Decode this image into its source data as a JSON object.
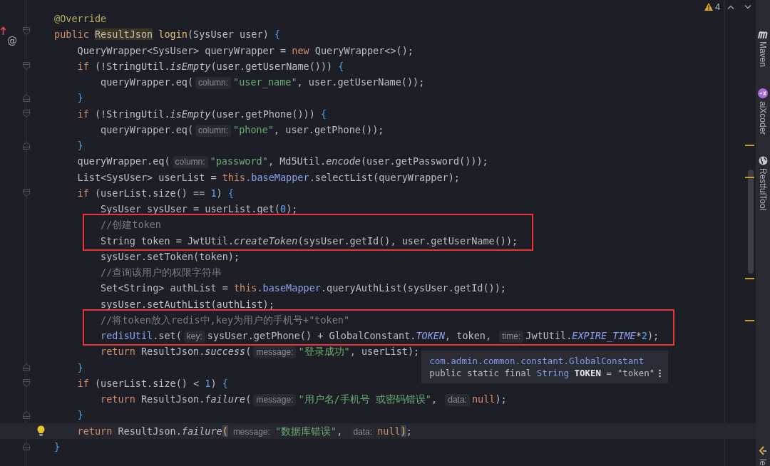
{
  "inspection": {
    "count": "4"
  },
  "lines": [
    {
      "current": false,
      "tokens": [
        {
          "kind": "annotation",
          "text": "@Override"
        }
      ]
    },
    {
      "current": false,
      "gutter": [
        {
          "kind": "override-arrow"
        },
        {
          "kind": "fold-start"
        }
      ],
      "gutter_label": "@",
      "tokens": [
        {
          "kind": "keyword",
          "text": "public "
        },
        {
          "kind": "usage",
          "text": "ResultJson"
        },
        {
          "kind": "method",
          "text": " login"
        },
        {
          "kind": "plain",
          "text": "(SysUser user) "
        },
        {
          "kind": "brace",
          "text": "{"
        }
      ]
    },
    {
      "current": false,
      "tokens": [
        {
          "kind": "plain",
          "text": "    QueryWrapper<SysUser> queryWrapper = "
        },
        {
          "kind": "keyword",
          "text": "new"
        },
        {
          "kind": "plain",
          "text": " QueryWrapper<>();"
        }
      ]
    },
    {
      "current": false,
      "gutter": [
        {
          "kind": "fold-start"
        }
      ],
      "tokens": [
        {
          "kind": "keyword",
          "text": "    if"
        },
        {
          "kind": "plain",
          "text": " (!StringUtil."
        },
        {
          "kind": "static-call",
          "text": "isEmpty"
        },
        {
          "kind": "plain",
          "text": "(user.getUserName())) "
        },
        {
          "kind": "brace",
          "text": "{"
        }
      ]
    },
    {
      "current": false,
      "tokens": [
        {
          "kind": "plain",
          "text": "        queryWrapper.eq("
        },
        {
          "kind": "hint",
          "text": "column:"
        },
        {
          "kind": "string",
          "text": "\"user_name\""
        },
        {
          "kind": "plain",
          "text": ", user.getUserName());"
        }
      ]
    },
    {
      "current": false,
      "gutter": [
        {
          "kind": "fold-end"
        }
      ],
      "tokens": [
        {
          "kind": "brace",
          "text": "    }"
        }
      ]
    },
    {
      "current": false,
      "gutter": [
        {
          "kind": "fold-start"
        }
      ],
      "tokens": [
        {
          "kind": "keyword",
          "text": "    if"
        },
        {
          "kind": "plain",
          "text": " (!StringUtil."
        },
        {
          "kind": "static-call",
          "text": "isEmpty"
        },
        {
          "kind": "plain",
          "text": "(user.getPhone())) "
        },
        {
          "kind": "brace",
          "text": "{"
        }
      ]
    },
    {
      "current": false,
      "tokens": [
        {
          "kind": "plain",
          "text": "        queryWrapper.eq("
        },
        {
          "kind": "hint",
          "text": "column:"
        },
        {
          "kind": "string",
          "text": "\"phone\""
        },
        {
          "kind": "plain",
          "text": ", user.getPhone());"
        }
      ]
    },
    {
      "current": false,
      "gutter": [
        {
          "kind": "fold-end"
        }
      ],
      "tokens": [
        {
          "kind": "brace",
          "text": "    }"
        }
      ]
    },
    {
      "current": false,
      "tokens": [
        {
          "kind": "plain",
          "text": "    queryWrapper.eq("
        },
        {
          "kind": "hint",
          "text": "column:"
        },
        {
          "kind": "string",
          "text": "\"password\""
        },
        {
          "kind": "plain",
          "text": ", Md5Util."
        },
        {
          "kind": "static-call",
          "text": "encode"
        },
        {
          "kind": "plain",
          "text": "(user.getPassword()));"
        }
      ]
    },
    {
      "current": false,
      "tokens": [
        {
          "kind": "plain",
          "text": "    List<SysUser> userList = "
        },
        {
          "kind": "keyword",
          "text": "this"
        },
        {
          "kind": "field",
          "text": ".baseMapper"
        },
        {
          "kind": "plain",
          "text": ".selectList(queryWrapper);"
        }
      ]
    },
    {
      "current": false,
      "gutter": [
        {
          "kind": "fold-start"
        }
      ],
      "tokens": [
        {
          "kind": "keyword",
          "text": "    if"
        },
        {
          "kind": "plain",
          "text": " (userList.size() == "
        },
        {
          "kind": "number",
          "text": "1"
        },
        {
          "kind": "plain",
          "text": ") "
        },
        {
          "kind": "brace",
          "text": "{"
        }
      ]
    },
    {
      "current": false,
      "tokens": [
        {
          "kind": "plain",
          "text": "        SysUser sysUser = userList.get("
        },
        {
          "kind": "number",
          "text": "0"
        },
        {
          "kind": "plain",
          "text": ");"
        }
      ]
    },
    {
      "current": false,
      "highlight": true,
      "tokens": [
        {
          "kind": "comment",
          "text": "        //创建token"
        }
      ]
    },
    {
      "current": false,
      "highlight": true,
      "tokens": [
        {
          "kind": "plain",
          "text": "        String token = JwtUtil."
        },
        {
          "kind": "static-call",
          "text": "createToken"
        },
        {
          "kind": "plain",
          "text": "(sysUser.getId(), user.getUserName());"
        }
      ]
    },
    {
      "current": false,
      "tokens": [
        {
          "kind": "plain",
          "text": "        sysUser.setToken(token);"
        }
      ]
    },
    {
      "current": false,
      "tokens": [
        {
          "kind": "comment",
          "text": "        //查询该用户的权限字符串"
        }
      ]
    },
    {
      "current": false,
      "tokens": [
        {
          "kind": "plain",
          "text": "        Set<String> authList = "
        },
        {
          "kind": "keyword",
          "text": "this"
        },
        {
          "kind": "field",
          "text": ".baseMapper"
        },
        {
          "kind": "plain",
          "text": ".queryAuthList(sysUser.getId());"
        }
      ]
    },
    {
      "current": false,
      "tokens": [
        {
          "kind": "plain",
          "text": "        sysUser.setAuthList(authList);"
        }
      ]
    },
    {
      "current": false,
      "highlight": true,
      "tokens": [
        {
          "kind": "comment",
          "text": "        //将token放入redis中,key为用户的手机号+\"token\""
        }
      ]
    },
    {
      "current": false,
      "highlight": true,
      "tokens": [
        {
          "kind": "field",
          "text": "        redisUtil"
        },
        {
          "kind": "plain",
          "text": ".set("
        },
        {
          "kind": "hint",
          "text": "key:"
        },
        {
          "kind": "plain",
          "text": "sysUser.getPhone() + GlobalConstant."
        },
        {
          "kind": "static-field",
          "text": "TOKEN"
        },
        {
          "kind": "plain",
          "text": ", token, "
        },
        {
          "kind": "hint",
          "text": "time:"
        },
        {
          "kind": "plain",
          "text": "JwtUtil."
        },
        {
          "kind": "static-field",
          "text": "EXPIRE_TIME"
        },
        {
          "kind": "plain",
          "text": "*"
        },
        {
          "kind": "number",
          "text": "2"
        },
        {
          "kind": "plain",
          "text": ");"
        }
      ]
    },
    {
      "current": false,
      "tokens": [
        {
          "kind": "keyword",
          "text": "        return"
        },
        {
          "kind": "plain",
          "text": " ResultJson."
        },
        {
          "kind": "static-call",
          "text": "success"
        },
        {
          "kind": "plain",
          "text": "("
        },
        {
          "kind": "hint",
          "text": "message:"
        },
        {
          "kind": "string",
          "text": "\"登录成功\""
        },
        {
          "kind": "plain",
          "text": ", userList);"
        }
      ],
      "tooltip": {
        "location": "com.admin.common.constant.GlobalConstant",
        "tokens": [
          {
            "kind": "plain",
            "text": "public static final "
          },
          {
            "kind": "type",
            "text": "String"
          },
          {
            "kind": "name",
            "text": " TOKEN"
          },
          {
            "kind": "plain",
            "text": " = \"token\""
          }
        ]
      }
    },
    {
      "current": false,
      "gutter": [
        {
          "kind": "fold-end"
        }
      ],
      "tokens": [
        {
          "kind": "brace",
          "text": "    }"
        }
      ]
    },
    {
      "current": false,
      "gutter": [
        {
          "kind": "fold-start"
        }
      ],
      "tokens": [
        {
          "kind": "keyword",
          "text": "    if"
        },
        {
          "kind": "plain",
          "text": " (userList.size() < "
        },
        {
          "kind": "number",
          "text": "1"
        },
        {
          "kind": "plain",
          "text": ") "
        },
        {
          "kind": "brace",
          "text": "{"
        }
      ]
    },
    {
      "current": false,
      "tokens": [
        {
          "kind": "keyword",
          "text": "        return"
        },
        {
          "kind": "plain",
          "text": " ResultJson."
        },
        {
          "kind": "static-call",
          "text": "failure"
        },
        {
          "kind": "plain",
          "text": "("
        },
        {
          "kind": "hint",
          "text": "message:"
        },
        {
          "kind": "string",
          "text": "\"用户名/手机号 或密码错误\""
        },
        {
          "kind": "plain",
          "text": ", "
        },
        {
          "kind": "hint",
          "text": "data:"
        },
        {
          "kind": "keyword",
          "text": "null"
        },
        {
          "kind": "plain",
          "text": ");"
        }
      ]
    },
    {
      "current": false,
      "gutter": [
        {
          "kind": "fold-end"
        }
      ],
      "tokens": [
        {
          "kind": "brace",
          "text": "    }"
        }
      ]
    },
    {
      "current": true,
      "gutter": [
        {
          "kind": "bulb"
        }
      ],
      "tokens": [
        {
          "kind": "keyword",
          "text": "    return"
        },
        {
          "kind": "plain",
          "text": " ResultJson."
        },
        {
          "kind": "static-call",
          "text": "failure"
        },
        {
          "kind": "matched",
          "text": "("
        },
        {
          "kind": "hint",
          "text": "message:"
        },
        {
          "kind": "string",
          "text": "\"数据库错误\""
        },
        {
          "kind": "plain",
          "text": ", "
        },
        {
          "kind": "hint",
          "text": "data:"
        },
        {
          "kind": "keyword",
          "text": "null"
        },
        {
          "kind": "matched",
          "text": ")"
        },
        {
          "kind": "plain",
          "text": ";"
        }
      ]
    },
    {
      "current": false,
      "gutter": [
        {
          "kind": "fold-end"
        }
      ],
      "tokens": [
        {
          "kind": "brace",
          "text": "}"
        }
      ]
    }
  ],
  "tool_strip": [
    {
      "kind": "maven",
      "label": "Maven"
    },
    {
      "kind": "aixcoder",
      "label": "aiXcoder"
    },
    {
      "kind": "restful",
      "label": "RestfulTool"
    },
    {
      "kind": "leetcode",
      "label": "le"
    }
  ]
}
